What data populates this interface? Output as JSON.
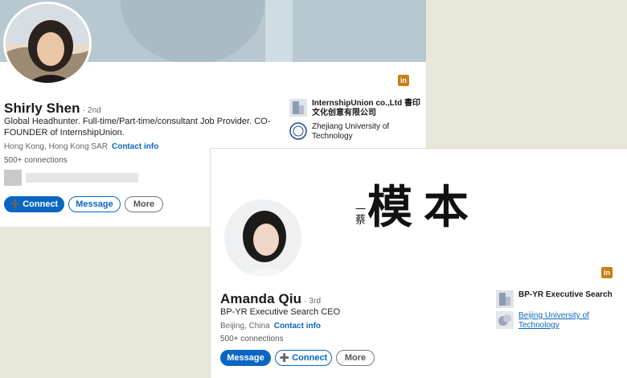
{
  "profile_top": {
    "name": "Shirly Shen",
    "degree": "· 2nd",
    "headline": "Global Headhunter. Full-time/Part-time/consultant Job Provider. CO-FOUNDER of InternshipUnion.",
    "location": "Hong Kong, Hong Kong SAR",
    "contact_link": "Contact info",
    "connections": "500+ connections",
    "buttons": {
      "connect": "Connect",
      "message": "Message",
      "more": "More"
    },
    "side": {
      "company": "InternshipUnion co.,Ltd 書印文化创意有限公司",
      "school": "Zhejiang University of Technology"
    },
    "badge": "in"
  },
  "profile_bottom": {
    "name": "Amanda Qiu",
    "degree": "· 3rd",
    "headline": "BP-YR Executive Search CEO",
    "location": "Beijing, China",
    "contact_link": "Contact info",
    "connections": "500+ connections",
    "buttons": {
      "message": "Message",
      "connect": "Connect",
      "more": "More"
    },
    "side": {
      "company": "BP-YR Executive Search",
      "school": "Beijing University of Technology"
    },
    "badge": "in",
    "calligraphy": {
      "main": "模本",
      "small": "一蔡"
    }
  },
  "colors": {
    "brand_blue": "#0a66c2",
    "linkedin_badge": "#c97e14",
    "banner": "#b7c8d1"
  },
  "icons": [
    "add-person-icon",
    "linkedin-icon",
    "company-logo-icon",
    "university-seal-icon"
  ]
}
